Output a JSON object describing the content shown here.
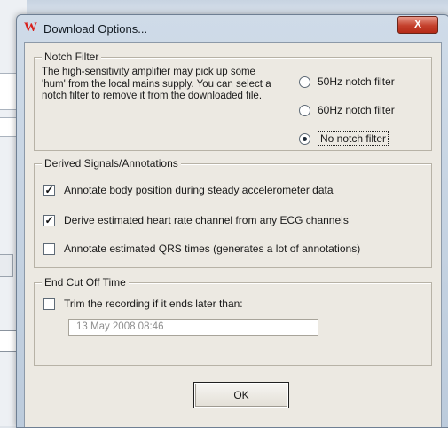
{
  "dialog": {
    "title": "Download Options...",
    "app_icon_glyph": "W",
    "close_glyph": "X"
  },
  "notch_filter": {
    "group_label": "Notch Filter",
    "description": "The high-sensitivity amplifier may pick up some 'hum' from the local mains supply. You can select a notch filter to remove it from the downloaded file.",
    "options": [
      {
        "label": "50Hz notch filter",
        "selected": false
      },
      {
        "label": "60Hz notch filter",
        "selected": false
      },
      {
        "label": "No notch filter",
        "selected": true
      }
    ]
  },
  "derived": {
    "group_label": "Derived Signals/Annotations",
    "items": [
      {
        "label": "Annotate body position during steady accelerometer data",
        "checked": true
      },
      {
        "label": "Derive estimated heart rate channel from any ECG channels",
        "checked": true
      },
      {
        "label": "Annotate estimated QRS times (generates a lot of annotations)",
        "checked": false
      }
    ]
  },
  "end_cutoff": {
    "group_label": "End Cut Off Time",
    "trim_label": "Trim the recording if it ends later than:",
    "trim_checked": false,
    "date_value": "13 May 2008  08:46"
  },
  "buttons": {
    "ok": "OK"
  },
  "colors": {
    "title_icon": "#d9201b",
    "close_button": "#c4402c",
    "dialog_face": "#ece9e2"
  }
}
